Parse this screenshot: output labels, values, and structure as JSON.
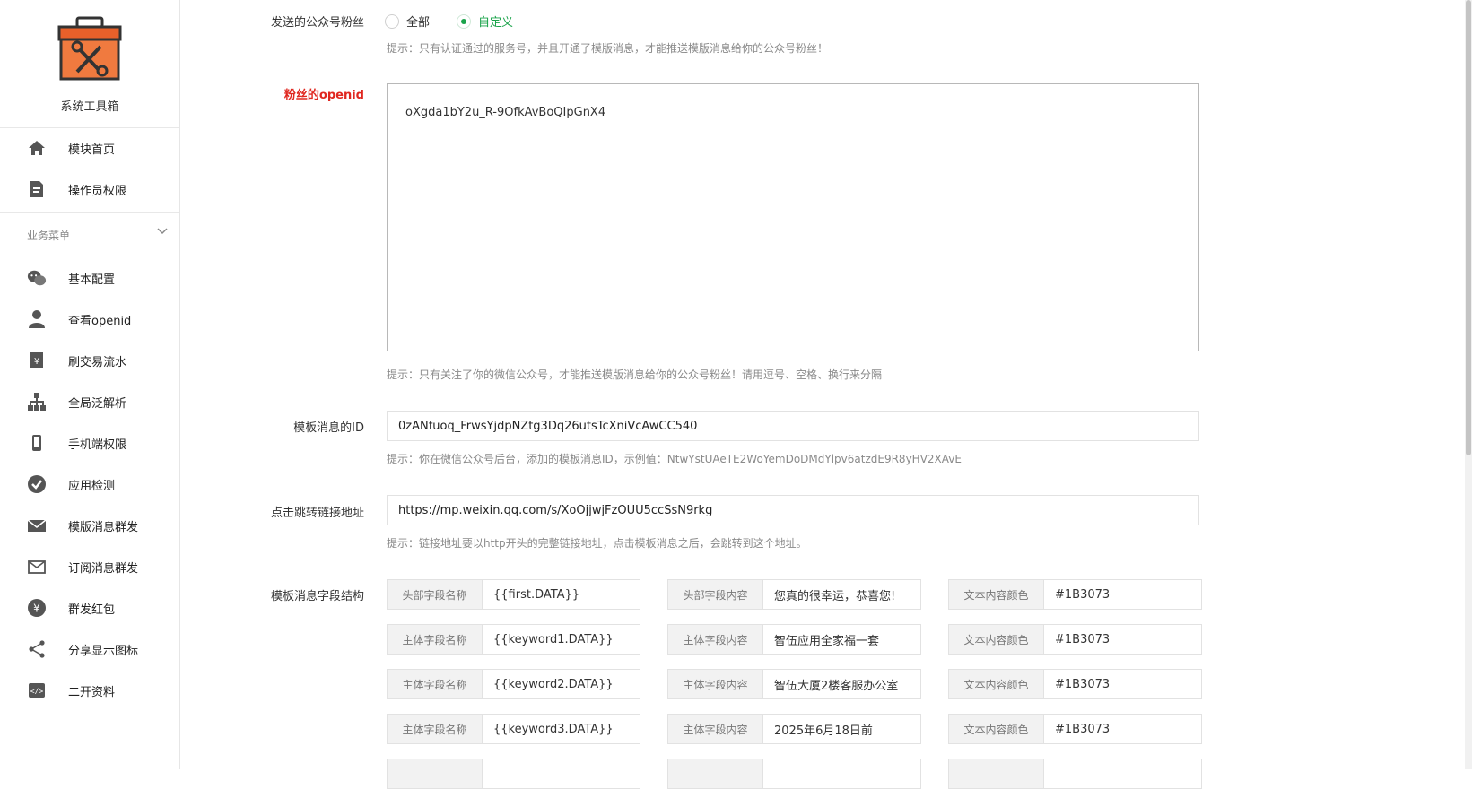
{
  "sidebar": {
    "app_name": "系统工具箱",
    "top_items": [
      {
        "label": "模块首页",
        "icon": "home-icon"
      },
      {
        "label": "操作员权限",
        "icon": "document-edit-icon"
      }
    ],
    "section_title": "业务菜单",
    "items": [
      {
        "label": "基本配置",
        "icon": "wechat-icon"
      },
      {
        "label": "查看openid",
        "icon": "user-icon"
      },
      {
        "label": "刷交易流水",
        "icon": "ledger-icon"
      },
      {
        "label": "全局泛解析",
        "icon": "sitemap-icon"
      },
      {
        "label": "手机端权限",
        "icon": "mobile-icon"
      },
      {
        "label": "应用检测",
        "icon": "check-circle-icon"
      },
      {
        "label": "模版消息群发",
        "icon": "envelope-filled-icon"
      },
      {
        "label": "订阅消息群发",
        "icon": "envelope-outline-icon"
      },
      {
        "label": "群发红包",
        "icon": "yen-circle-icon"
      },
      {
        "label": "分享显示图标",
        "icon": "share-icon"
      },
      {
        "label": "二开资料",
        "icon": "code-icon"
      }
    ]
  },
  "form": {
    "fans": {
      "label": "发送的公众号粉丝",
      "options": [
        "全部",
        "自定义"
      ],
      "selected": "自定义",
      "hint": "提示：只有认证通过的服务号，并且开通了模版消息，才能推送模版消息给你的公众号粉丝！"
    },
    "openid": {
      "label": "粉丝的openid",
      "value": "oXgda1bY2u_R-9OfkAvBoQIpGnX4",
      "hint": "提示：只有关注了你的微信公众号，才能推送模版消息给你的公众号粉丝！请用逗号、空格、换行来分隔"
    },
    "template_id": {
      "label": "模板消息的ID",
      "value": "0zANfuoq_FrwsYjdpNZtg3Dq26utsTcXniVcAwCC540",
      "hint": "提示：你在微信公众号后台，添加的模板消息ID，示例值：NtwYstUAeTE2WoYemDoDMdYlpv6atzdE9R8yHV2XAvE"
    },
    "link": {
      "label": "点击跳转链接地址",
      "value": "https://mp.weixin.qq.com/s/XoOjjwjFzOUU5ccSsN9rkg",
      "hint": "提示：链接地址要以http开头的完整链接地址，点击模板消息之后，会跳转到这个地址。"
    },
    "fields": {
      "label": "模板消息字段结构",
      "rows": [
        {
          "name_label": "头部字段名称",
          "name_value": "{{first.DATA}}",
          "content_label": "头部字段内容",
          "content_value": "您真的很幸运，恭喜您!",
          "color_label": "文本内容颜色",
          "color_value": "#1B3073"
        },
        {
          "name_label": "主体字段名称",
          "name_value": "{{keyword1.DATA}}",
          "content_label": "主体字段内容",
          "content_value": "智伍应用全家福一套",
          "color_label": "文本内容颜色",
          "color_value": "#1B3073"
        },
        {
          "name_label": "主体字段名称",
          "name_value": "{{keyword2.DATA}}",
          "content_label": "主体字段内容",
          "content_value": "智伍大厦2楼客服办公室",
          "color_label": "文本内容颜色",
          "color_value": "#1B3073"
        },
        {
          "name_label": "主体字段名称",
          "name_value": "{{keyword3.DATA}}",
          "content_label": "主体字段内容",
          "content_value": "2025年6月18日前",
          "color_label": "文本内容颜色",
          "color_value": "#1B3073"
        }
      ]
    }
  },
  "colors": {
    "accent_green": "#1aa34a",
    "required_red": "#e0271f",
    "logo_orange": "#e8602a"
  }
}
